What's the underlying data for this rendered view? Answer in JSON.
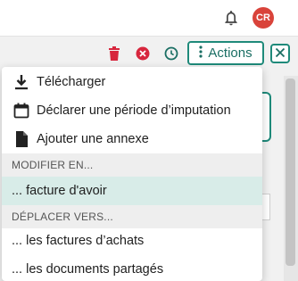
{
  "colors": {
    "accent": "#1f8a7a",
    "avatar_bg": "#d9433a",
    "delete_red": "#d7263d",
    "highlight_bg": "#d8ece8"
  },
  "header": {
    "bell_icon": "bell-icon",
    "avatar_initials": "CR"
  },
  "toolbar": {
    "delete_icon": "trash-icon",
    "cancel_icon": "x-circle-icon",
    "history_icon": "clock-icon",
    "actions_label": "Actions",
    "actions_icon": "vertical-dots-icon",
    "close_icon": "close-icon"
  },
  "menu": {
    "items": [
      {
        "label": "Télécharger",
        "icon": "download-icon"
      },
      {
        "label": "Déclarer une période d’imputation",
        "icon": "calendar-icon"
      },
      {
        "label": "Ajouter une annexe",
        "icon": "file-icon"
      }
    ],
    "modify_header": "MODIFIER EN...",
    "modify_items": [
      {
        "label": "... facture d'avoir"
      }
    ],
    "move_header": "DÉPLACER VERS...",
    "move_items": [
      {
        "label": "... les factures d’achats"
      },
      {
        "label": "... les documents partagés"
      }
    ]
  }
}
